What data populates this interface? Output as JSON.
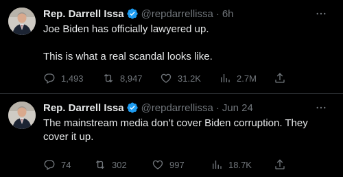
{
  "colors": {
    "background": "#000000",
    "text_primary": "#e7e9ea",
    "text_secondary": "#71767b",
    "verified_badge": "#1d9bf0",
    "divider": "#2f3336"
  },
  "tweets": [
    {
      "author_name": "Rep. Darrell Issa",
      "handle": "@repdarrellissa",
      "separator": "·",
      "time": "6h",
      "verified_icon": "verified-badge-icon",
      "text_lines": [
        "Joe Biden has officially lawyered up.",
        "This is what a real scandal looks like."
      ],
      "replies": "1,493",
      "retweets": "8,947",
      "likes": "31.2K",
      "views": "2.7M"
    },
    {
      "author_name": "Rep. Darrell Issa",
      "handle": "@repdarrellissa",
      "separator": "·",
      "time": "Jun 24",
      "verified_icon": "verified-badge-icon",
      "text_lines": [
        "The mainstream media don’t cover Biden corruption. They cover it up."
      ],
      "replies": "74",
      "retweets": "302",
      "likes": "997",
      "views": "18.7K"
    }
  ]
}
